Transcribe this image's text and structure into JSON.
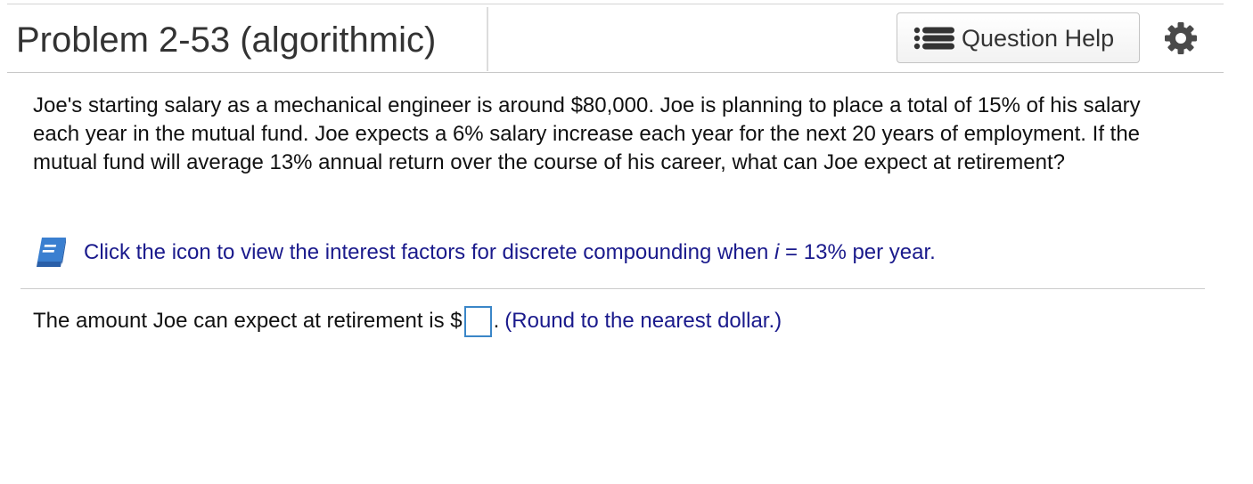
{
  "header": {
    "title": "Problem 2-53 (algorithmic)",
    "help_button_label": "Question Help",
    "help_icon": "list-icon",
    "settings_icon": "gear-icon"
  },
  "problem": {
    "text": "Joe's starting salary as a mechanical engineer is around $80,000. Joe is planning to place a total of 15% of his salary each year in the mutual fund. Joe expects a 6% salary increase each year for the next 20 years of employment. If the mutual fund will average 13% annual return over the course of his career, what can Joe expect at retirement?"
  },
  "resource": {
    "icon": "book-icon",
    "link_prefix": "Click the icon to view the interest factors for discrete compounding when ",
    "link_var": "i",
    "link_suffix": " = 13% per year."
  },
  "answer": {
    "prefix": "The amount Joe can expect at retirement is $",
    "input_value": "",
    "suffix": ".",
    "note": "(Round to the nearest dollar.)"
  },
  "colors": {
    "link": "#1a1a8c",
    "input_border": "#3a86c8",
    "book_icon": "#3a7fd0"
  }
}
